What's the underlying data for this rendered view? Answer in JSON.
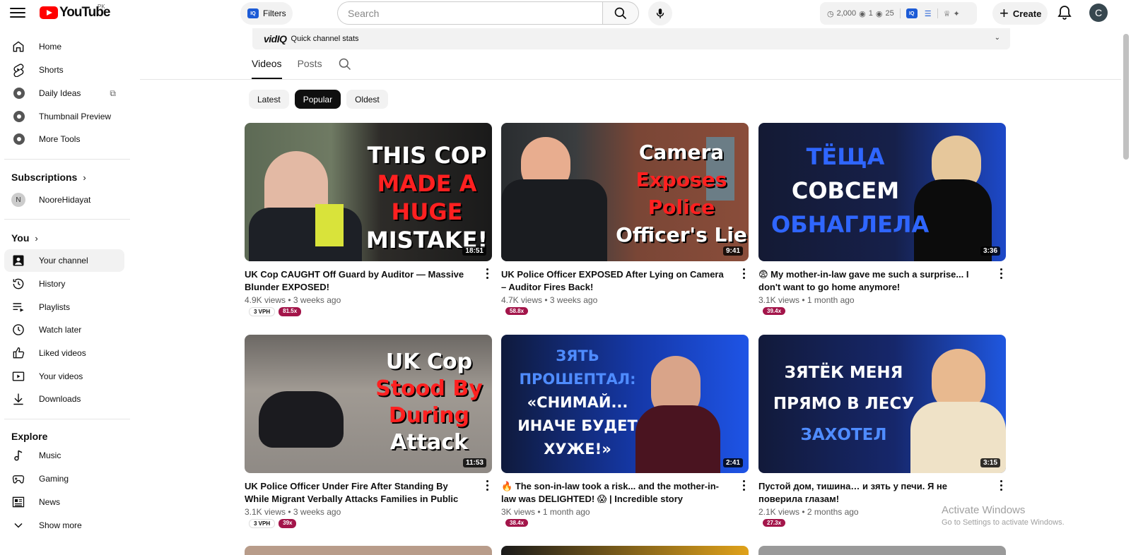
{
  "header": {
    "logo_text": "YouTube",
    "region": "PK",
    "filters_label": "Filters",
    "iq_badge": "IQ",
    "search_placeholder": "Search",
    "stats": {
      "views": "2,000",
      "watching": "1",
      "subs": "25"
    },
    "create_label": "Create",
    "avatar_initial": "C"
  },
  "sidebar": {
    "main": [
      {
        "label": "Home",
        "icon": "home-icon"
      },
      {
        "label": "Shorts",
        "icon": "shorts-icon"
      },
      {
        "label": "Daily Ideas",
        "icon": "vidiq-icon"
      },
      {
        "label": "Thumbnail Preview",
        "icon": "vidiq-icon"
      },
      {
        "label": "More Tools",
        "icon": "vidiq-icon"
      }
    ],
    "subscriptions_title": "Subscriptions",
    "subscriptions": [
      {
        "label": "NooreHidayat",
        "initial": "N"
      }
    ],
    "you_title": "You",
    "you": [
      {
        "label": "Your channel",
        "icon": "channel-icon"
      },
      {
        "label": "History",
        "icon": "history-icon"
      },
      {
        "label": "Playlists",
        "icon": "playlists-icon"
      },
      {
        "label": "Watch later",
        "icon": "watch-later-icon"
      },
      {
        "label": "Liked videos",
        "icon": "like-icon"
      },
      {
        "label": "Your videos",
        "icon": "your-videos-icon"
      },
      {
        "label": "Downloads",
        "icon": "download-icon"
      }
    ],
    "explore_title": "Explore",
    "explore": [
      {
        "label": "Music",
        "icon": "music-icon"
      },
      {
        "label": "Gaming",
        "icon": "gaming-icon"
      },
      {
        "label": "News",
        "icon": "news-icon"
      },
      {
        "label": "Show more",
        "icon": "chevron-down-icon"
      }
    ]
  },
  "vidiq_bar": {
    "logo": "vidIQ",
    "label": "Quick channel stats"
  },
  "tabs": [
    "Videos",
    "Posts"
  ],
  "chips": [
    "Latest",
    "Popular",
    "Oldest"
  ],
  "videos": [
    {
      "title": "UK Cop CAUGHT Off Guard by Auditor — Massive Blunder EXPOSED!",
      "meta": "4.9K views • 3 weeks ago",
      "duration": "18:51",
      "vph": "3 VPH",
      "mult": "81.5x",
      "thumb_lines": [
        "THIS COP",
        "MADE A",
        "HUGE",
        "MISTAKE!"
      ]
    },
    {
      "title": "UK Police Officer EXPOSED After Lying on Camera – Auditor Fires Back!",
      "meta": "4.7K views • 3 weeks ago",
      "duration": "9:41",
      "vph": "",
      "mult": "58.8x",
      "thumb_lines": [
        "Camera",
        "Exposes",
        "Police",
        "Officer's Lie"
      ]
    },
    {
      "title": "😨 My mother-in-law gave me such a surprise... I don't want to go home anymore!",
      "meta": "3.1K views • 1 month ago",
      "duration": "3:36",
      "vph": "",
      "mult": "39.4x",
      "thumb_lines": [
        "ТЁЩА",
        "СОВСЕМ",
        "ОБНАГЛЕЛА"
      ]
    },
    {
      "title": "UK Police Officer Under Fire After Standing By While Migrant Verbally Attacks Families in Public",
      "meta": "3.1K views • 3 weeks ago",
      "duration": "11:53",
      "vph": "3 VPH",
      "mult": "39x",
      "thumb_lines": [
        "UK Cop",
        "Stood By",
        "During",
        "Attack"
      ]
    },
    {
      "title": "🔥 The son-in-law took a risk... and the mother-in-law was DELIGHTED! 😱 | Incredible story",
      "meta": "3K views • 1 month ago",
      "duration": "2:41",
      "vph": "",
      "mult": "38.4x",
      "thumb_lines": [
        "ЗЯТЬ",
        "ПРОШЕПТАЛ:",
        "«СНИМАЙ...",
        "ИНАЧЕ БУДЕТ",
        "ХУЖЕ!»"
      ]
    },
    {
      "title": "Пустой дом, тишина… и зять у печи. Я не поверила глазам!",
      "meta": "2.1K views • 2 months ago",
      "duration": "3:15",
      "vph": "",
      "mult": "27.3x",
      "thumb_lines": [
        "ЗЯТЁК МЕНЯ",
        "ПРЯМО В ЛЕСУ",
        "ЗАХОТЕЛ"
      ]
    }
  ],
  "watermark": {
    "line1": "Activate Windows",
    "line2": "Go to Settings to activate Windows."
  }
}
